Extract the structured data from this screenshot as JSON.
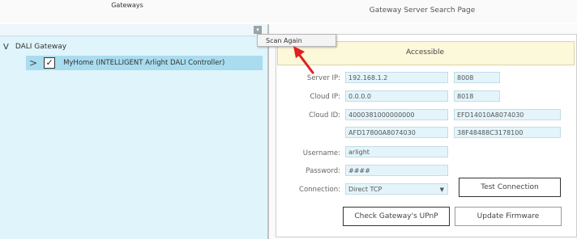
{
  "page_title": "Gateway Server Search Page",
  "gateways": {
    "header": "Gateways",
    "dropdown_icon": "chevron-down-icon",
    "root_chevron": "V",
    "root_label": "DALI Gateway",
    "child_arrow": ">",
    "child_check": "✓",
    "child_label": "MyHome (INTELLIGENT Arlight DALI Controller)"
  },
  "context_menu": {
    "scan_again": "Scan Again"
  },
  "status": {
    "text": "Accessible",
    "bg_color": "#fcf8da"
  },
  "form": {
    "server_ip_label": "Server IP:",
    "server_ip": "192.168.1.2",
    "server_port": "8008",
    "cloud_ip_label": "Cloud IP:",
    "cloud_ip": "0.0.0.0",
    "cloud_port": "8018",
    "cloud_id_label": "Cloud ID:",
    "cloud_id_1": "4000381000000000",
    "cloud_id_2": "EFD14010A8074030",
    "cloud_id_3": "AFD17800A8074030",
    "cloud_id_4": "38F48488C3178100",
    "username_label": "Username:",
    "username": "arlight",
    "password_label": "Password:",
    "password": "####",
    "connection_label": "Connection:",
    "connection": "Direct TCP",
    "connection_caret": "▼"
  },
  "buttons": {
    "test_connection": "Test Connection",
    "check_upnp": "Check Gateway's UPnP",
    "update_firmware": "Update Firmware"
  },
  "annotation": {
    "arrow_color": "#e02020"
  }
}
